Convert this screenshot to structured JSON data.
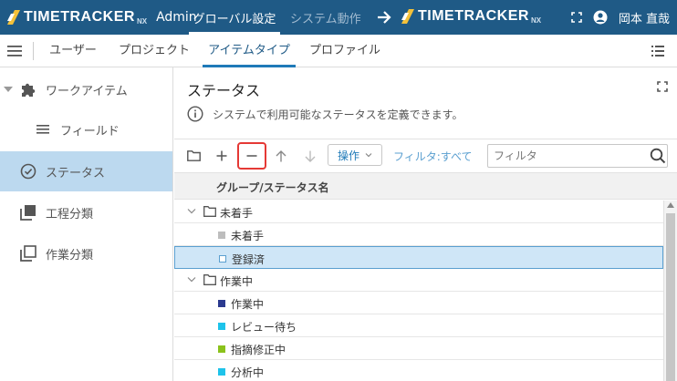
{
  "header": {
    "logo_text": "TIMETRACKER",
    "logo_nx": "NX",
    "admin_label": "Admin",
    "tabs": [
      {
        "label": "グローバル設定",
        "active": true
      },
      {
        "label": "システム動作",
        "active": false
      }
    ],
    "linked_app_logo_text": "TIMETRACKER",
    "linked_app_logo_nx": "NX",
    "user_name": "岡本 直哉"
  },
  "subnav": {
    "tabs": [
      {
        "label": "ユーザー",
        "active": false
      },
      {
        "label": "プロジェクト",
        "active": false
      },
      {
        "label": "アイテムタイプ",
        "active": true
      },
      {
        "label": "プロファイル",
        "active": false
      }
    ]
  },
  "sidebar": {
    "items": [
      {
        "label": "ワークアイテム",
        "icon": "puzzle-icon",
        "expanded": true
      },
      {
        "label": "フィールド",
        "icon": "list-lines-icon"
      },
      {
        "label": "ステータス",
        "icon": "check-circle-icon",
        "active": true
      },
      {
        "label": "工程分類",
        "icon": "stacked-squares-icon"
      },
      {
        "label": "作業分類",
        "icon": "copy-squares-icon"
      }
    ]
  },
  "main": {
    "title": "ステータス",
    "info": "システムで利用可能なステータスを定義できます。",
    "toolbar": {
      "ops_label": "操作",
      "filter_label": "フィルタ:すべて",
      "filter_placeholder": "フィルタ"
    },
    "table": {
      "column_header": "グループ/ステータス名",
      "rows": [
        {
          "type": "group",
          "label": "未着手"
        },
        {
          "type": "status",
          "label": "未着手",
          "color": "#bdbdbd"
        },
        {
          "type": "status",
          "label": "登録済",
          "color": "#ffffff",
          "selected": true
        },
        {
          "type": "group",
          "label": "作業中"
        },
        {
          "type": "status",
          "label": "作業中",
          "color": "#2b3a8f"
        },
        {
          "type": "status",
          "label": "レビュー待ち",
          "color": "#1ec3ea"
        },
        {
          "type": "status",
          "label": "指摘修正中",
          "color": "#8bc21c"
        },
        {
          "type": "status",
          "label": "分析中",
          "color": "#1ec3ea"
        }
      ]
    }
  },
  "colors": {
    "header_bg": "#1f5a86",
    "accent": "#1f7ab8",
    "selection_bg": "#bcd9ef",
    "highlight_border": "#e53935"
  }
}
